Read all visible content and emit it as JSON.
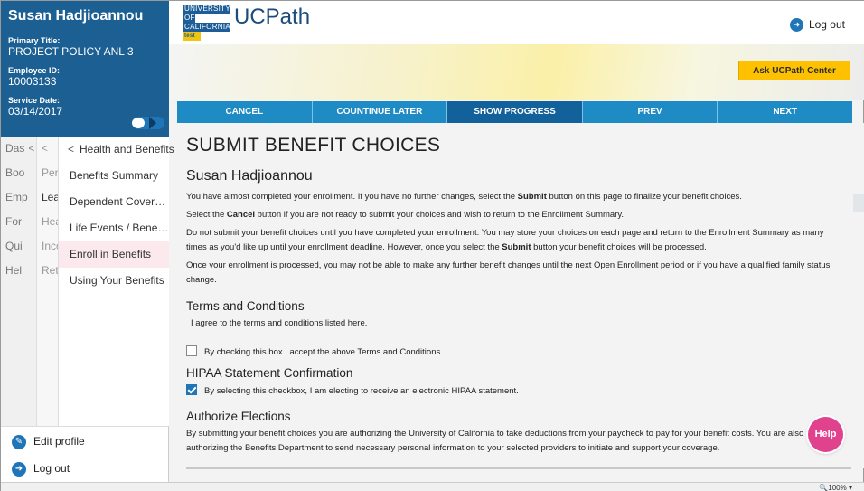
{
  "profile": {
    "name": "Susan Hadjioannou",
    "primary_title_label": "Primary Title:",
    "primary_title": "PROJECT POLICY ANL 3",
    "employee_id_label": "Employee ID:",
    "employee_id": "10003133",
    "service_date_label": "Service Date:",
    "service_date": "03/14/2017"
  },
  "nav": {
    "col1": [
      "Das",
      "Boo",
      "Emp",
      "For",
      "Qui",
      "Hel"
    ],
    "col2": [
      "",
      "Pers",
      "Lea",
      "Hea",
      "Inco",
      "Ret"
    ],
    "back_label": "Health and Benefits",
    "items": [
      "Benefits Summary",
      "Dependent Covera...",
      "Life Events / Benef...",
      "Enroll in Benefits",
      "Using Your Benefits"
    ],
    "active_index": 3
  },
  "profile_actions": {
    "edit_profile": "Edit profile",
    "log_out": "Log out"
  },
  "header": {
    "logo_line1": "UNIVERSITY",
    "logo_line2": "OF",
    "logo_line3": "CALIFORNIA",
    "logo_badge": "test",
    "app_name": "UCPath",
    "log_out": "Log out"
  },
  "banner": {
    "ask_button": "Ask UCPath Center"
  },
  "toolbar": {
    "cancel": "CANCEL",
    "continue_later": "COUNTINUE LATER",
    "show_progress": "SHOW PROGRESS",
    "prev": "PREV",
    "next": "NEXT"
  },
  "content": {
    "title": "SUBMIT BENEFIT CHOICES",
    "person_name": "Susan Hadjioannou",
    "para1_a": "You have almost completed your enrollment. If you have no further changes, select the ",
    "para1_b": "Submit",
    "para1_c": " button on this page to finalize your benefit choices.",
    "para2_a": "Select the ",
    "para2_b": "Cancel",
    "para2_c": " button if you are not ready to submit your choices and wish to return to the Enrollment Summary.",
    "para3_a": "Do not submit your benefit choices until you have completed your enrollment. You may store your choices on each page and return to the Enrollment Summary as many times as you'd like up until your enrollment deadline. However, once you select the ",
    "para3_b": "Submit",
    "para3_c": " button your benefit choices will be processed.",
    "para4": "Once your enrollment is processed, you may not be able to make any further benefit changes until the next Open Enrollment period or if you have a qualified family status change.",
    "terms_heading": "Terms and Conditions",
    "terms_text": "I agree to the terms and conditions listed here.",
    "terms_checkbox": "By checking this box I accept the above Terms and Conditions",
    "terms_checked": false,
    "hipaa_heading": "HIPAA Statement Confirmation",
    "hipaa_checkbox": "By selecting this checkbox, I am electing to receive an electronic HIPAA statement.",
    "hipaa_checked": true,
    "auth_heading": "Authorize Elections",
    "auth_text": "By submitting your benefit choices you are authorizing the University of California to take deductions from your paycheck to pay for your benefit costs. You are also authorizing the Benefits Department to send necessary personal information to your selected providers to initiate and support your coverage."
  },
  "help_label": "Help",
  "zoom": "100%",
  "colors": {
    "profile_bg": "#1b5f93",
    "toolbar_bg": "#1e8bc5",
    "toolbar_active": "#13619b",
    "ask_button": "#fdc100",
    "help_button": "#e0428e",
    "active_nav": "#fbe9ee"
  }
}
